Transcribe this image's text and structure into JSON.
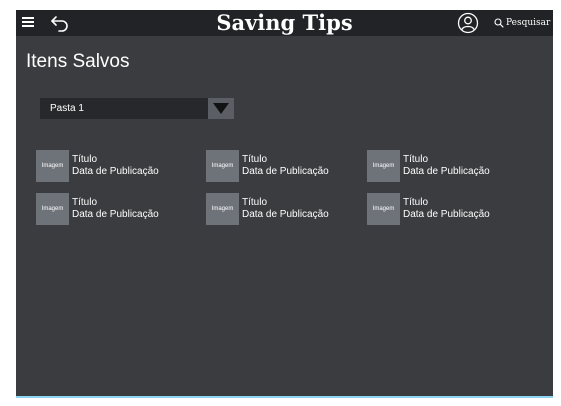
{
  "header": {
    "title": "Saving Tips",
    "search_label": "Pesquisar"
  },
  "page": {
    "title": "Itens Salvos"
  },
  "folder": {
    "selected": "Pasta 1"
  },
  "saved_items": [
    {
      "image_label": "Imagem",
      "title": "Título",
      "date": "Data de Publicação"
    },
    {
      "image_label": "Imagem",
      "title": "Título",
      "date": "Data de Publicação"
    },
    {
      "image_label": "Imagem",
      "title": "Título",
      "date": "Data de Publicação"
    },
    {
      "image_label": "Imagem",
      "title": "Título",
      "date": "Data de Publicação"
    },
    {
      "image_label": "Imagem",
      "title": "Título",
      "date": "Data de Publicação"
    },
    {
      "image_label": "Imagem",
      "title": "Título",
      "date": "Data de Publicação"
    }
  ],
  "icons": {
    "menu": "hamburger-menu-icon",
    "back": "back-arrow-icon",
    "user": "user-profile-icon",
    "search": "search-icon",
    "dropdown": "triangle-down-icon"
  },
  "colors": {
    "app_background": "#3a3c3f",
    "topbar_background": "#212326",
    "thumbnail": "#6e7379",
    "accent_line": "#8fd3f2"
  }
}
